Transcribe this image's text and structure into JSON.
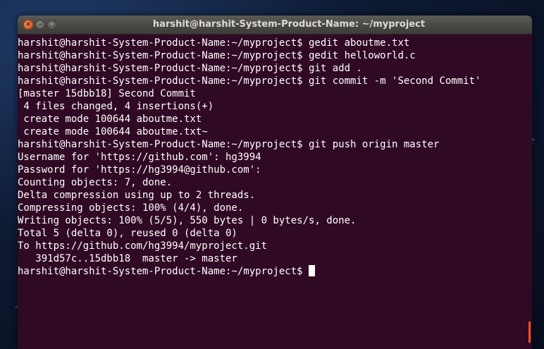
{
  "window": {
    "title": "harshit@harshit-System-Product-Name: ~/myproject",
    "controls": {
      "close": "×",
      "minimize": "–",
      "maximize": "□"
    }
  },
  "terminal": {
    "lines": [
      "harshit@harshit-System-Product-Name:~/myproject$ gedit aboutme.txt",
      "harshit@harshit-System-Product-Name:~/myproject$ gedit helloworld.c",
      "harshit@harshit-System-Product-Name:~/myproject$ git add .",
      "harshit@harshit-System-Product-Name:~/myproject$ git commit -m 'Second Commit'",
      "[master 15dbb18] Second Commit",
      " 4 files changed, 4 insertions(+)",
      " create mode 100644 aboutme.txt",
      " create mode 100644 aboutme.txt~",
      "harshit@harshit-System-Product-Name:~/myproject$ git push origin master",
      "Username for 'https://github.com': hg3994",
      "Password for 'https://hg3994@github.com':",
      "Counting objects: 7, done.",
      "Delta compression using up to 2 threads.",
      "Compressing objects: 100% (4/4), done.",
      "Writing objects: 100% (5/5), 550 bytes | 0 bytes/s, done.",
      "Total 5 (delta 0), reused 0 (delta 0)",
      "To https://github.com/hg3994/myproject.git",
      "   391d57c..15dbb18  master -> master"
    ],
    "prompt": "harshit@harshit-System-Product-Name:~/myproject$ "
  },
  "colors": {
    "terminal_bg": "#300a24",
    "text": "#ffffff",
    "titlebar": "#3c3b37",
    "close_button": "#e25a27"
  }
}
